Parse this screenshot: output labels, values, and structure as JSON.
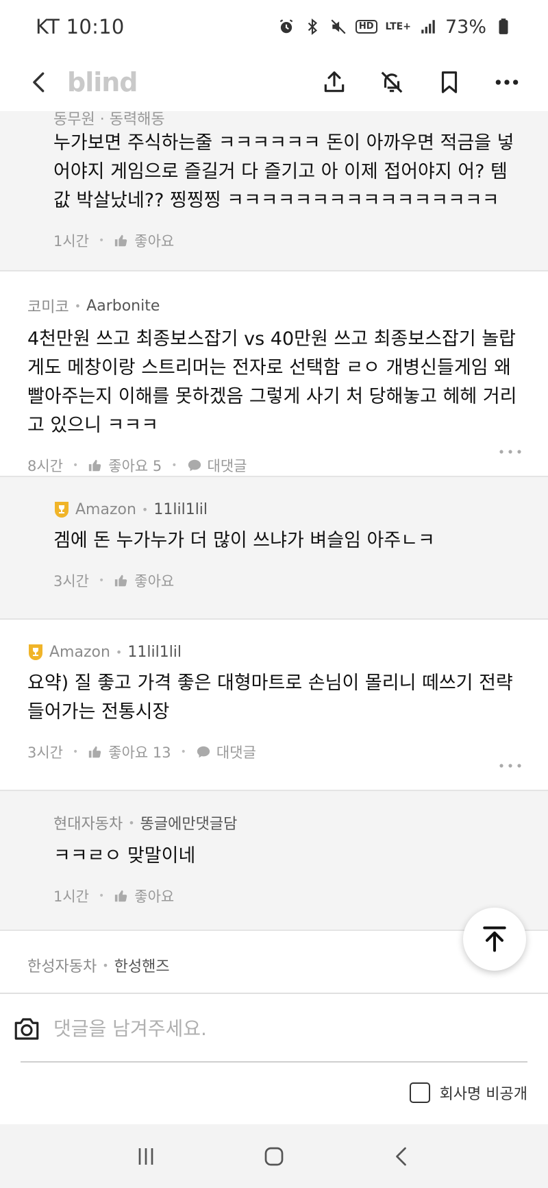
{
  "status_bar": {
    "carrier_time": "KT 10:10",
    "hd": "HD",
    "lte": "LTE+",
    "battery": "73%"
  },
  "navbar": {
    "logo": "blind",
    "icons": [
      "back-icon",
      "share-icon",
      "bell-off-icon",
      "bookmark-icon",
      "more-icon"
    ]
  },
  "comments": [
    {
      "type": "reply",
      "partial": true,
      "meta_cut": "동무원 · 동력해동",
      "text": "누가보면 주식하는줄 ㅋㅋㅋㅋㅋㅋ 돈이 아까우면 적금을 넣어야지 게임으로 즐길거 다 즐기고  아 이제 접어야지 어? 템값 박살났네?? 찡찡찡 ㅋㅋㅋㅋㅋㅋㅋㅋㅋㅋㅋㅋㅋㅋㅋㅋ",
      "time": "1시간",
      "like": "좋아요"
    },
    {
      "type": "top",
      "company": "코미코",
      "nick": "Aarbonite",
      "text": "4천만원 쓰고 최종보스잡기 vs 40만원 쓰고 최종보스잡기 놀랍게도 메창이랑 스트리머는 전자로 선택함 ㄹㅇ 개병신들게임 왜 빨아주는지 이해를 못하겠음 그렇게 사기 처 당해놓고 헤헤 거리고 있으니 ㅋㅋㅋ",
      "time": "8시간",
      "like": "좋아요 5",
      "reply": "대댓글"
    },
    {
      "type": "reply",
      "badge": true,
      "company": "Amazon",
      "nick": "11lil1lil",
      "text": "겜에 돈 누가누가 더 많이 쓰냐가 벼슬임 아주ㄴㅋ",
      "time": "3시간",
      "like": "좋아요"
    },
    {
      "type": "top",
      "badge": true,
      "company": "Amazon",
      "nick": "11lil1lil",
      "text": "요약) 질 좋고 가격 좋은 대형마트로 손님이 몰리니 떼쓰기 전략 들어가는 전통시장",
      "time": "3시간",
      "like": "좋아요 13",
      "reply": "대댓글"
    },
    {
      "type": "reply",
      "company": "현대자동차",
      "nick": "똥글에만댓글담",
      "text": "ㅋㅋㄹㅇ 맞말이네",
      "time": "1시간",
      "like": "좋아요"
    },
    {
      "type": "top",
      "partial_bottom": true,
      "company": "한성자동차",
      "nick": "한성핸즈"
    }
  ],
  "input": {
    "placeholder": "댓글을 남겨주세요.",
    "anon_label": "회사명 비공개"
  },
  "colors": {
    "badge_gold": "#f0b429",
    "logo_gray": "#c9c9c9",
    "reply_bg": "#f4f4f4"
  }
}
